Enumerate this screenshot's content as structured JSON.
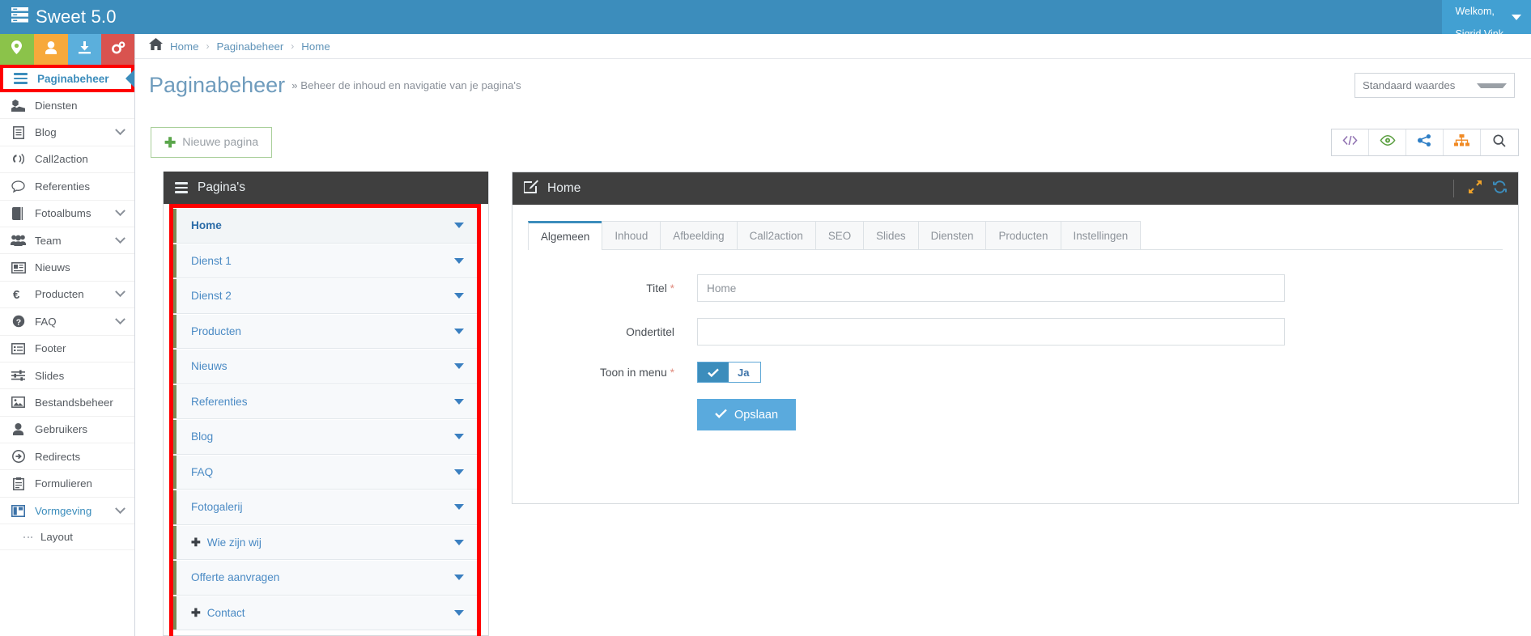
{
  "header": {
    "brand": "Sweet 5.0",
    "brand_icon": "server-stack-icon",
    "welcome_line1": "Welkom,",
    "welcome_line2": "Sigrid Vink",
    "accent_color": "#3c8dbc"
  },
  "quick_actions": [
    {
      "name": "map-marker-icon",
      "color": "#8bc34a"
    },
    {
      "name": "user-icon",
      "color": "#f7a93b"
    },
    {
      "name": "download-icon",
      "color": "#5bafdc"
    },
    {
      "name": "cogs-icon",
      "color": "#d9534f"
    }
  ],
  "sidebar": {
    "active_item": {
      "label": "Paginabeheer",
      "icon": "hamburger-icon"
    },
    "items": [
      {
        "label": "Diensten",
        "icon": "cubes-icon",
        "expandable": false
      },
      {
        "label": "Blog",
        "icon": "file-text-icon",
        "expandable": true
      },
      {
        "label": "Call2action",
        "icon": "bullhorn-icon",
        "expandable": false
      },
      {
        "label": "Referenties",
        "icon": "comment-icon",
        "expandable": false
      },
      {
        "label": "Fotoalbums",
        "icon": "book-icon",
        "expandable": true
      },
      {
        "label": "Team",
        "icon": "users-icon",
        "expandable": true
      },
      {
        "label": "Nieuws",
        "icon": "newspaper-icon",
        "expandable": false
      },
      {
        "label": "Producten",
        "icon": "euro-icon",
        "expandable": true
      },
      {
        "label": "FAQ",
        "icon": "question-circle-icon",
        "expandable": true
      },
      {
        "label": "Footer",
        "icon": "list-alt-icon",
        "expandable": false
      },
      {
        "label": "Slides",
        "icon": "sliders-icon",
        "expandable": false
      },
      {
        "label": "Bestandsbeheer",
        "icon": "image-icon",
        "expandable": false
      },
      {
        "label": "Gebruikers",
        "icon": "user-icon",
        "expandable": false
      },
      {
        "label": "Redirects",
        "icon": "arrow-circle-right-icon",
        "expandable": false
      },
      {
        "label": "Formulieren",
        "icon": "clipboard-icon",
        "expandable": false
      },
      {
        "label": "Vormgeving",
        "icon": "columns-icon",
        "expandable": true,
        "open": true
      }
    ],
    "submenu": [
      {
        "label": "Layout"
      }
    ]
  },
  "breadcrumb": {
    "home_icon": "home-icon",
    "items": [
      "Home",
      "Paginabeheer",
      "Home"
    ],
    "separator": "›"
  },
  "page": {
    "title": "Paginabeheer",
    "subtitle": "» Beheer de inhoud en navigatie van je pagina's",
    "values_select": "Standaard waardes"
  },
  "toolbar": {
    "new_page_label": "Nieuwe pagina",
    "new_page_icon": "plus-icon",
    "icons": [
      {
        "name": "code-icon",
        "color": "#8e6fb0"
      },
      {
        "name": "eye-icon",
        "color": "#5a9e3f"
      },
      {
        "name": "share-icon",
        "color": "#2f7fc6"
      },
      {
        "name": "sitemap-icon",
        "color": "#f08a24"
      },
      {
        "name": "search-icon",
        "color": "#4a4f55"
      }
    ]
  },
  "pages_panel": {
    "title": "Pagina's",
    "title_icon": "hamburger-icon",
    "rows": [
      {
        "label": "Home",
        "has_plus": false,
        "active": true
      },
      {
        "label": "Dienst 1",
        "has_plus": false,
        "active": false
      },
      {
        "label": "Dienst 2",
        "has_plus": false,
        "active": false
      },
      {
        "label": "Producten",
        "has_plus": false,
        "active": false
      },
      {
        "label": "Nieuws",
        "has_plus": false,
        "active": false
      },
      {
        "label": "Referenties",
        "has_plus": false,
        "active": false
      },
      {
        "label": "Blog",
        "has_plus": false,
        "active": false
      },
      {
        "label": "FAQ",
        "has_plus": false,
        "active": false
      },
      {
        "label": "Fotogalerij",
        "has_plus": false,
        "active": false
      },
      {
        "label": "Wie zijn wij",
        "has_plus": true,
        "active": false
      },
      {
        "label": "Offerte aanvragen",
        "has_plus": false,
        "active": false
      },
      {
        "label": "Contact",
        "has_plus": true,
        "active": false
      }
    ]
  },
  "edit_panel": {
    "title": "Home",
    "title_icon": "pencil-square-icon",
    "expand_icon": "expand-arrows-icon",
    "refresh_icon": "refresh-icon",
    "tabs": [
      {
        "label": "Algemeen",
        "active": true
      },
      {
        "label": "Inhoud",
        "active": false
      },
      {
        "label": "Afbeelding",
        "active": false
      },
      {
        "label": "Call2action",
        "active": false
      },
      {
        "label": "SEO",
        "active": false
      },
      {
        "label": "Slides",
        "active": false
      },
      {
        "label": "Diensten",
        "active": false
      },
      {
        "label": "Producten",
        "active": false
      },
      {
        "label": "Instellingen",
        "active": false
      }
    ],
    "form": {
      "titel_label": "Titel",
      "titel_required": "*",
      "titel_value": "",
      "titel_placeholder": "Home",
      "ondertitel_label": "Ondertitel",
      "ondertitel_value": "",
      "ondertitel_placeholder": "",
      "toon_label": "Toon in menu",
      "toon_required": "*",
      "toon_value": "Ja",
      "toon_checked_icon": "check-icon",
      "save_label": "Opslaan",
      "save_icon": "check-icon"
    }
  },
  "highlight_color": "#ff0000"
}
